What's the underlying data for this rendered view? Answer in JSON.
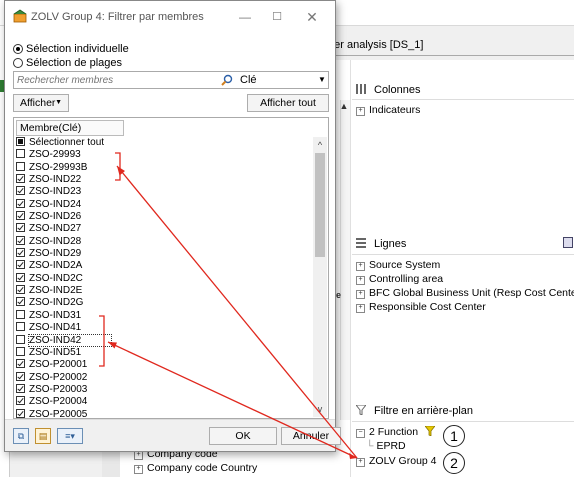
{
  "background": {
    "report_title": "nter analysis [DS_1]",
    "columns_label": "Colonnes",
    "indicators_label": "Indicateurs",
    "rows_label": "Lignes",
    "rows": [
      "Source System",
      "Controlling area",
      "BFC Global Business Unit (Resp Cost Center)",
      "Responsible Cost Center"
    ],
    "filter_label": "Filtre en arrière-plan",
    "filter_items": [
      "2 Function",
      "EPRD",
      "ZOLV Group 4"
    ],
    "bottom_list": [
      "Company code",
      "Company code Country"
    ],
    "markers": [
      "1",
      "2"
    ],
    "left_tick": "[",
    "mid_tick": "ste"
  },
  "dialog": {
    "title": "ZOLV Group 4: Filtrer par membres",
    "radio_individual": "Sélection individuelle",
    "radio_ranges": "Sélection de plages",
    "search_placeholder": "Rechercher membres",
    "search_key": "Clé",
    "afficher": "Afficher",
    "afficher_tout": "Afficher tout",
    "column_header": "Membre(Clé)",
    "select_all": "Sélectionner tout",
    "members": [
      {
        "label": "ZSO-29993",
        "checked": false
      },
      {
        "label": "ZSO-29993B",
        "checked": false
      },
      {
        "label": "ZSO-IND22",
        "checked": true
      },
      {
        "label": "ZSO-IND23",
        "checked": true
      },
      {
        "label": "ZSO-IND24",
        "checked": true
      },
      {
        "label": "ZSO-IND26",
        "checked": true
      },
      {
        "label": "ZSO-IND27",
        "checked": true
      },
      {
        "label": "ZSO-IND28",
        "checked": true
      },
      {
        "label": "ZSO-IND29",
        "checked": true
      },
      {
        "label": "ZSO-IND2A",
        "checked": true
      },
      {
        "label": "ZSO-IND2C",
        "checked": true
      },
      {
        "label": "ZSO-IND2E",
        "checked": true
      },
      {
        "label": "ZSO-IND2G",
        "checked": true
      },
      {
        "label": "ZSO-IND31",
        "checked": false
      },
      {
        "label": "ZSO-IND41",
        "checked": false
      },
      {
        "label": "ZSO-IND42",
        "checked": false
      },
      {
        "label": "ZSO-IND51",
        "checked": false
      },
      {
        "label": "ZSO-P20001",
        "checked": true
      },
      {
        "label": "ZSO-P20002",
        "checked": true
      },
      {
        "label": "ZSO-P20003",
        "checked": true
      },
      {
        "label": "ZSO-P20004",
        "checked": true
      },
      {
        "label": "ZSO-P20005",
        "checked": true
      }
    ],
    "ok": "OK",
    "cancel": "Annuler",
    "min_glyph": "—",
    "max_glyph": "☐",
    "close_glyph": "✕"
  },
  "colors": {
    "annotation_red": "#e0281e",
    "filter_funnel": "#d4b400"
  }
}
